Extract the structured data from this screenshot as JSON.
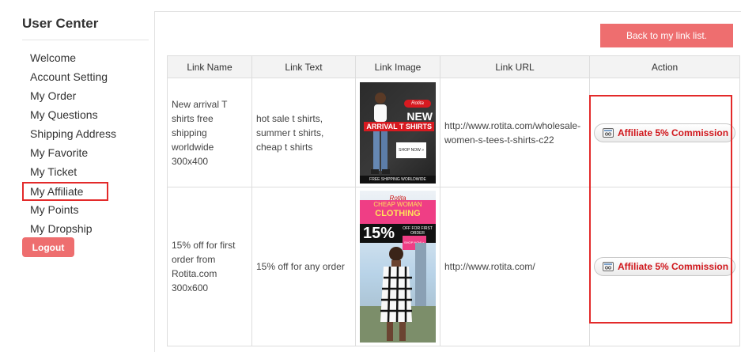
{
  "sidebar": {
    "title": "User Center",
    "items": [
      {
        "label": "Welcome"
      },
      {
        "label": "Account Setting"
      },
      {
        "label": "My Order"
      },
      {
        "label": "My Questions"
      },
      {
        "label": "Shipping Address"
      },
      {
        "label": "My Favorite"
      },
      {
        "label": "My Ticket"
      },
      {
        "label": "My Affiliate",
        "active": true
      },
      {
        "label": "My Points"
      },
      {
        "label": "My Dropship"
      }
    ],
    "logout_label": "Logout"
  },
  "main": {
    "back_button_label": "Back to my link list.",
    "table": {
      "headers": [
        "Link Name",
        "Link Text",
        "Link Image",
        "Link URL",
        "Action"
      ],
      "rows": [
        {
          "name": "New arrival T shirts free shipping worldwide 300x400",
          "text": "hot sale t shirts, summer t shirts, cheap t shirts",
          "url": "http://www.rotita.com/wholesale-women-s-tees-t-shirts-c22",
          "action": "Affiliate 5% Commission",
          "image": {
            "logo": "Rotita",
            "line1": "NEW",
            "line2": "ARRIVAL T SHIRTS",
            "cta": "SHOP NOW »",
            "footer": "FREE SHIPPING WORLDWIDE"
          }
        },
        {
          "name": "15% off for first order from Rotita.com 300x600",
          "text": "15% off for any order",
          "url": "http://www.rotita.com/",
          "action": "Affiliate 5% Commission",
          "image": {
            "logo": "Rotita",
            "line1": "CHEAP WOMAN",
            "line2": "CLOTHING",
            "percent": "15%",
            "off": "OFF FOR FIRST ORDER",
            "cta": "SHOP NOW »"
          }
        }
      ]
    }
  },
  "colors": {
    "accent": "#ee6e6f",
    "highlight": "#e32a2a",
    "commission_text": "#d0161b"
  },
  "icons": [
    "affiliate-link-icon"
  ]
}
